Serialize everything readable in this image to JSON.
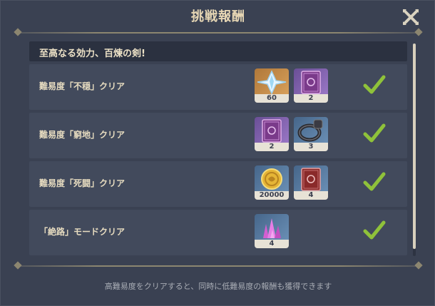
{
  "dialog": {
    "title": "挑戦報酬",
    "close_icon": "close-icon",
    "footer_note": "高難易度をクリアすると、同時に低難易度の報酬も獲得できます"
  },
  "header": {
    "title": "至高なる効力、百煉の剣!"
  },
  "rows": [
    {
      "label": "難易度「不穏」クリア",
      "rewards": [
        {
          "icon": "primogem-icon",
          "count": "60",
          "rarity": "gold"
        },
        {
          "icon": "book-icon",
          "count": "2",
          "rarity": "purple"
        }
      ],
      "completed": true
    },
    {
      "label": "難易度「窮地」クリア",
      "rewards": [
        {
          "icon": "book-icon",
          "count": "2",
          "rarity": "purple"
        },
        {
          "icon": "ring-icon",
          "count": "3",
          "rarity": "blue"
        }
      ],
      "completed": true
    },
    {
      "label": "難易度「死闘」クリア",
      "rewards": [
        {
          "icon": "mora-coin-icon",
          "count": "20000",
          "rarity": "blue"
        },
        {
          "icon": "book-icon",
          "count": "4",
          "rarity": "blue"
        }
      ],
      "completed": true
    },
    {
      "label": "「絶路」モードクリア",
      "rewards": [
        {
          "icon": "crystal-icon",
          "count": "4",
          "rarity": "blue"
        }
      ],
      "completed": true
    }
  ],
  "colors": {
    "panel_bg": "#3a4152",
    "row_bg": "#424a5c",
    "title_text": "#e6d6b4",
    "check_green": "#8fc23a"
  }
}
